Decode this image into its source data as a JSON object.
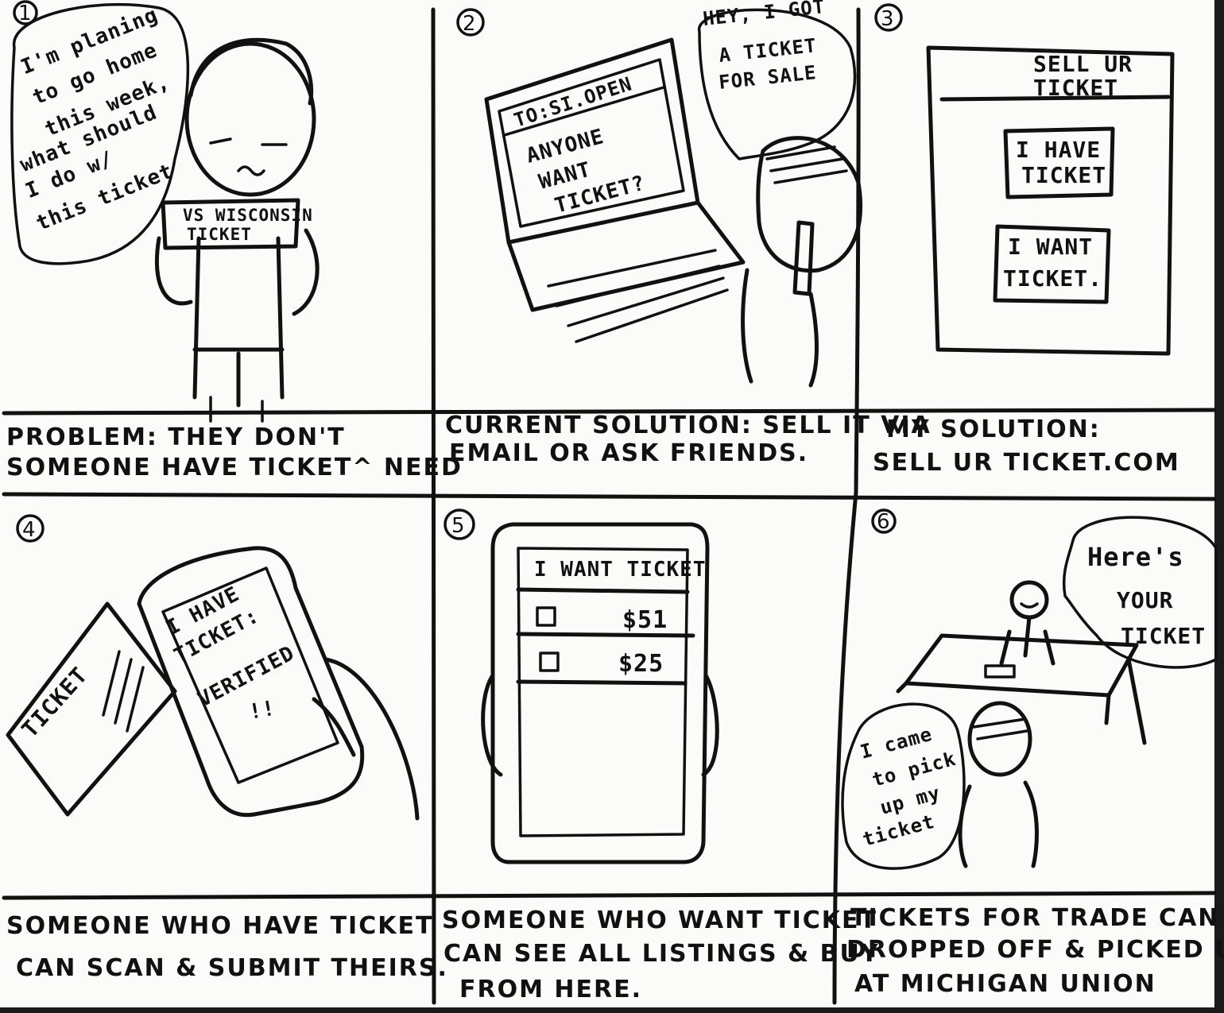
{
  "panels": [
    {
      "number": "1",
      "speech": [
        "I'm planing",
        "to go home",
        "this week,",
        "what should",
        "I do w/",
        "this ticket"
      ],
      "ticket_lines": [
        "VS WISCONSIN",
        "TICKET"
      ],
      "caption": [
        "PROBLEM:         THEY DON'T",
        "SOMEONE HAVE TICKET^ NEED"
      ]
    },
    {
      "number": "2",
      "email_to": "TO:SI.OPEN",
      "email_body": [
        "ANYONE",
        "WANT",
        "TICKET?"
      ],
      "speech": [
        "HEY, I GOT",
        "A TICKET",
        "FOR SALE"
      ],
      "caption": [
        "CURRENT SOLUTION: SELL IT VIA",
        "EMAIL OR ASK FRIENDS."
      ]
    },
    {
      "number": "3",
      "app_title": [
        "SELL UR",
        "TICKET"
      ],
      "buttons": [
        [
          "I HAVE",
          "TICKET"
        ],
        [
          "I WANT",
          "TICKET."
        ]
      ],
      "caption": [
        "MY SOLUTION:",
        "SELL UR TICKET.COM"
      ]
    },
    {
      "number": "4",
      "paper_label": "TICKET",
      "screen": [
        "I HAVE",
        "TICKET:",
        "VERIFIED",
        "!!"
      ],
      "caption": [
        "SOMEONE WHO HAVE TICKET",
        "CAN SCAN & SUBMIT THEIRS."
      ]
    },
    {
      "number": "5",
      "screen_title": "I WANT TICKET",
      "listings": [
        {
          "price": "$51"
        },
        {
          "price": "$25"
        }
      ],
      "caption": [
        "SOMEONE WHO WANT TICKET",
        "CAN SEE ALL LISTINGS & BUY",
        "FROM HERE."
      ]
    },
    {
      "number": "6",
      "speech_staff": [
        "Here's",
        "YOUR",
        "TICKET"
      ],
      "speech_customer": [
        "I came",
        "to pick",
        "up my",
        "ticket"
      ],
      "caption": [
        "TICKETS FOR TRADE CAN BE",
        "DROPPED OFF & PICKED UP",
        "AT MICHIGAN UNION"
      ]
    }
  ]
}
